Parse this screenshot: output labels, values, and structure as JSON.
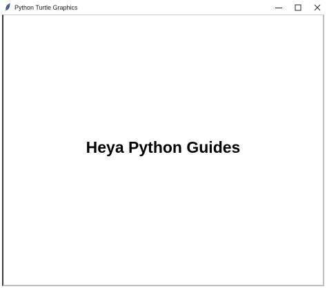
{
  "window": {
    "title": "Python Turtle Graphics",
    "app_icon": "feather-icon",
    "controls": {
      "minimize_icon": "minimize-icon",
      "maximize_icon": "maximize-icon",
      "close_icon": "close-icon"
    }
  },
  "canvas": {
    "written_text": "Heya Python Guides",
    "text_color": "#000000",
    "background_color": "#ffffff"
  }
}
